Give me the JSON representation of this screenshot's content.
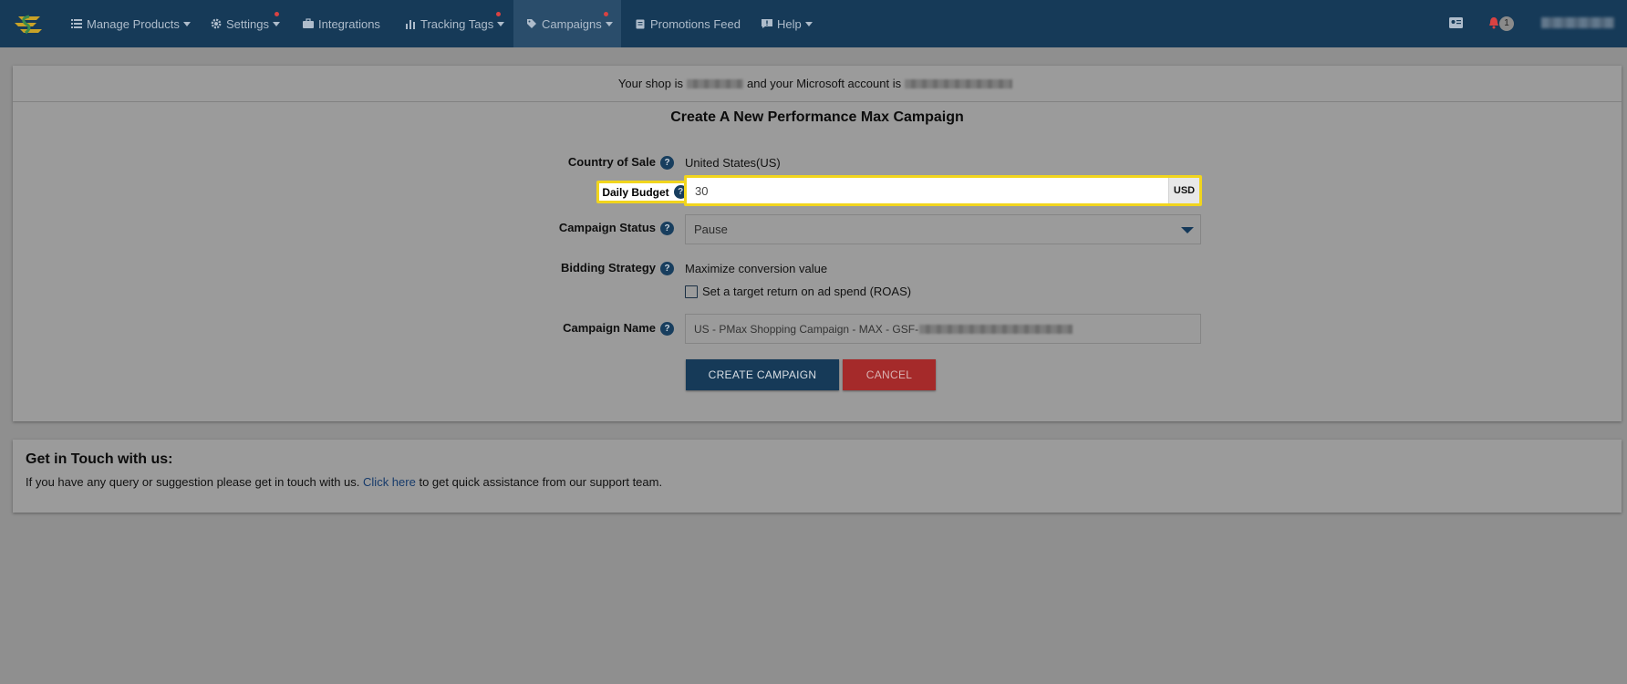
{
  "nav": {
    "items": [
      {
        "label": "Manage Products",
        "icon": "list-icon",
        "has_caret": true,
        "has_dot": false
      },
      {
        "label": "Settings",
        "icon": "gear-icon",
        "has_caret": true,
        "has_dot": true
      },
      {
        "label": "Integrations",
        "icon": "briefcase-icon",
        "has_caret": false,
        "has_dot": false
      },
      {
        "label": "Tracking Tags",
        "icon": "bar-chart-icon",
        "has_caret": true,
        "has_dot": true
      },
      {
        "label": "Campaigns",
        "icon": "tag-icon",
        "has_caret": true,
        "has_dot": true,
        "active": true
      },
      {
        "label": "Promotions Feed",
        "icon": "clipboard-icon",
        "has_caret": false,
        "has_dot": false
      },
      {
        "label": "Help",
        "icon": "chat-exclamation-icon",
        "has_caret": true,
        "has_dot": false
      }
    ],
    "notification_count": "1"
  },
  "shop_bar": {
    "prefix": "Your shop is",
    "middle": "and your Microsoft account is"
  },
  "form": {
    "title": "Create A New Performance Max Campaign",
    "country_label": "Country of Sale",
    "country_value": "United States(US)",
    "budget_label": "Daily Budget",
    "budget_value": "30",
    "budget_currency": "USD",
    "status_label": "Campaign Status",
    "status_value": "Pause",
    "bidding_label": "Bidding Strategy",
    "bidding_value": "Maximize conversion value",
    "roas_label": "Set a target return on ad spend (ROAS)",
    "name_label": "Campaign Name",
    "name_value": "US - PMax Shopping Campaign - MAX - GSF-",
    "help_glyph": "?",
    "create_button": "CREATE CAMPAIGN",
    "cancel_button": "CANCEL"
  },
  "contact": {
    "title": "Get in Touch with us:",
    "text_before": "If you have any query or suggestion please get in touch with us.",
    "link_text": "Click here",
    "text_after": "to get quick assistance from our support team."
  },
  "colors": {
    "navbar": "#163a58",
    "highlight": "#f1d51d",
    "create_button": "#163a58",
    "cancel_button": "#a52a2a"
  }
}
